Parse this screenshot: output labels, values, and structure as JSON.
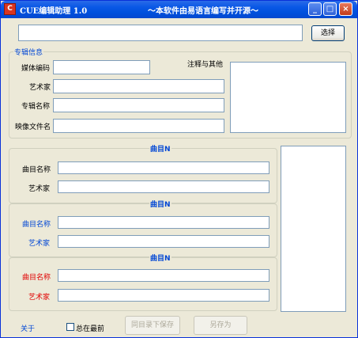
{
  "window": {
    "icon_glyph": "C",
    "title": "CUE编辑助理 1.0",
    "slogan": "～本软件由易语言编写并开源～",
    "minimize_glyph": "_",
    "maximize_glyph": "□",
    "close_glyph": "×"
  },
  "file_bar": {
    "path_value": "",
    "select_button": "选择"
  },
  "album": {
    "group_title": "专辑信息",
    "media_code_label": "媒体编码",
    "media_code_value": "",
    "artist_label": "艺术家",
    "artist_value": "",
    "album_name_label": "专辑名称",
    "album_name_value": "",
    "image_file_label": "映像文件名",
    "image_file_value": "",
    "comment_label": "注释与其他",
    "comment_value": ""
  },
  "tracks": [
    {
      "header": "曲目N",
      "title_label": "曲目名称",
      "artist_label": "艺术家",
      "title_value": "",
      "artist_value": ""
    },
    {
      "header": "曲目N",
      "title_label": "曲目名称",
      "artist_label": "艺术家",
      "title_value": "",
      "artist_value": ""
    },
    {
      "header": "曲目N",
      "title_label": "曲目名称",
      "artist_label": "艺术家",
      "title_value": "",
      "artist_value": ""
    }
  ],
  "footer": {
    "about_label": "关于",
    "always_on_top_label": "总在最前",
    "always_on_top_checked": false,
    "save_same_dir_button": "同目录下保存",
    "save_as_button": "另存为"
  },
  "colors": {
    "titlebar": "#0a58e6",
    "window_bg": "#ece9d8",
    "label_blue": "#0046d5",
    "label_red": "#e00000"
  }
}
